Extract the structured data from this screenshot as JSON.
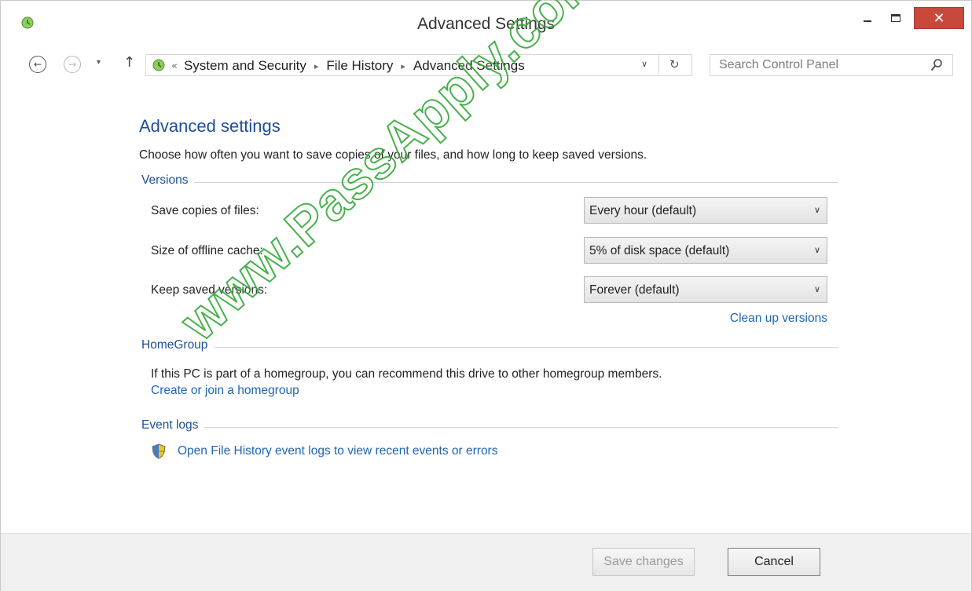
{
  "window": {
    "title": "Advanced Settings",
    "close_glyph": "✕"
  },
  "nav": {
    "back_glyph": "←",
    "forward_glyph": "→",
    "recent_glyph": "▾",
    "up_glyph": "↑",
    "address": {
      "prefix": "«",
      "crumbs": [
        "System and Security",
        "File History",
        "Advanced Settings"
      ],
      "separator": "▸",
      "dropdown_glyph": "∨",
      "refresh_glyph": "↻"
    },
    "search": {
      "placeholder": "Search Control Panel",
      "value": ""
    }
  },
  "content": {
    "heading": "Advanced settings",
    "intro": "Choose how often you want to save copies of your files, and how long to keep saved versions.",
    "versions": {
      "label": "Versions",
      "rows": [
        {
          "label": "Save copies of files:",
          "value": "Every hour (default)"
        },
        {
          "label": "Size of offline cache:",
          "value": "5% of disk space (default)"
        },
        {
          "label": "Keep saved versions:",
          "value": "Forever (default)"
        }
      ],
      "dropdown_arrow": "∨",
      "cleanup_link": "Clean up versions"
    },
    "homegroup": {
      "label": "HomeGroup",
      "text": "If this PC is part of a homegroup, you can recommend this drive to other homegroup members.",
      "link": "Create or join a homegroup"
    },
    "event_logs": {
      "label": "Event logs",
      "link": "Open File History event logs to view recent events or errors"
    }
  },
  "footer": {
    "save_label": "Save changes",
    "cancel_label": "Cancel"
  },
  "watermark": "www.PassApply.com",
  "colors": {
    "heading": "#1e4e95",
    "link": "#1f64b3",
    "close_button": "#c9483c",
    "watermark": "#35a83a"
  }
}
